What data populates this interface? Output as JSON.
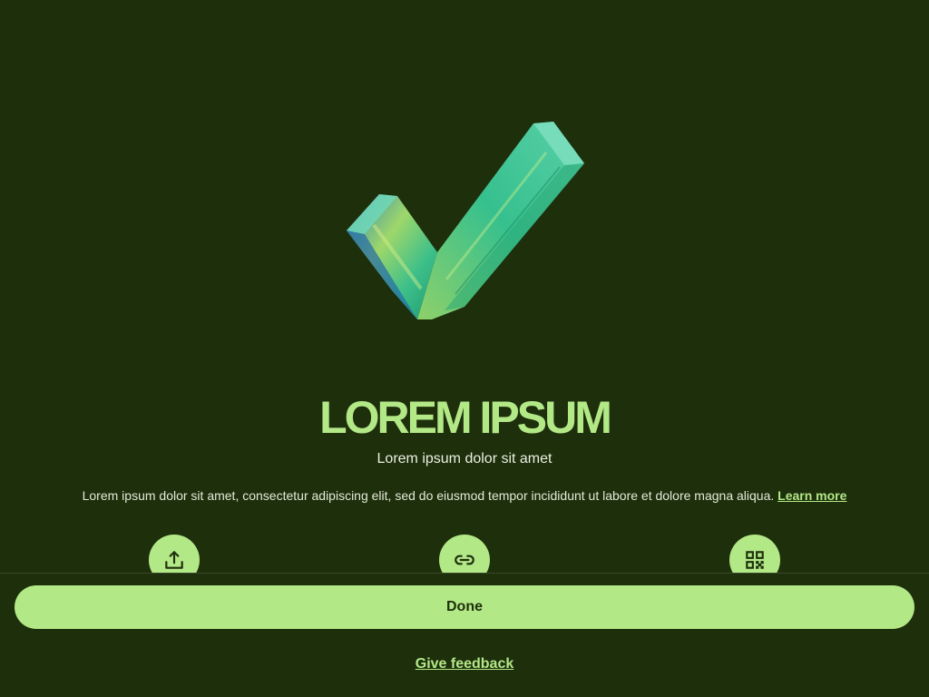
{
  "hero": {
    "icon": "checkmark-3d-icon"
  },
  "title": "LOREM IPSUM",
  "subtitle": "Lorem ipsum dolor sit amet",
  "description": {
    "text": "Lorem ipsum dolor sit amet, consectetur adipiscing elit, sed do eiusmod tempor incididunt ut labore et dolore magna aliqua.",
    "link_label": "Learn more"
  },
  "actions": [
    {
      "icon": "share-upload-icon"
    },
    {
      "icon": "link-icon"
    },
    {
      "icon": "qr-code-icon"
    }
  ],
  "footer": {
    "done_label": "Done",
    "feedback_label": "Give feedback"
  },
  "colors": {
    "background": "#1e2f0c",
    "accent": "#b3e887",
    "text": "#eef3e6"
  }
}
